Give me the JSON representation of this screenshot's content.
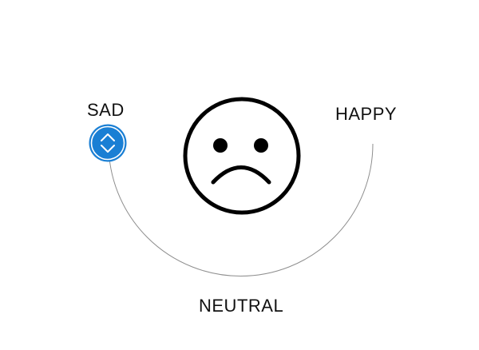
{
  "mood_selector": {
    "labels": {
      "sad": "SAD",
      "happy": "HAPPY",
      "neutral": "NEUTRAL"
    },
    "current_mood": "sad",
    "face": {
      "expression": "frown",
      "icon": "sad-face-icon"
    },
    "handle": {
      "icon": "up-down-chevron-icon",
      "color": "#1a7fd4"
    }
  }
}
